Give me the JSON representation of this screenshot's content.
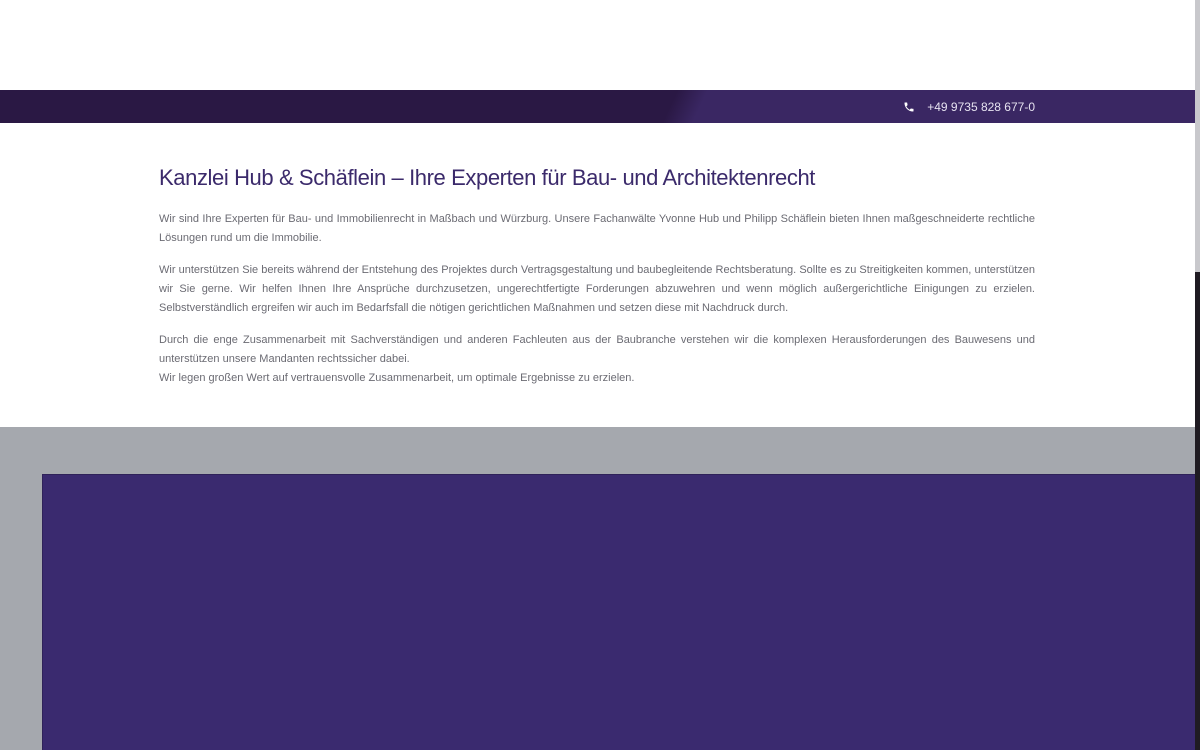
{
  "topbar": {
    "phone": "+49 9735 828 677-0",
    "phone_icon": "phone-icon"
  },
  "intro": {
    "title": "Kanzlei Hub & Schäflein – Ihre Experten für Bau- und Architektenrecht",
    "paragraphs": [
      "Wir sind Ihre Experten für Bau- und Immobilienrecht in Maßbach und Würzburg. Unsere Fachanwälte Yvonne Hub und Philipp Schäflein bieten Ihnen maßgeschneiderte rechtliche Lösungen rund um die Immobilie.",
      "Wir unterstützen Sie bereits während der Entstehung des Projektes durch Vertragsgestaltung und baubegleitende Rechtsberatung. Sollte es zu Streitigkeiten kommen, unterstützen wir Sie gerne. Wir helfen Ihnen Ihre Ansprüche durchzusetzen, ungerechtfertigte Forderungen abzuwehren und wenn möglich außergerichtliche Einigungen zu erzielen. Selbstverständlich ergreifen wir auch im Bedarfsfall die nötigen gerichtlichen Maßnahmen und setzen diese mit Nachdruck durch.",
      "Durch die enge Zusammenarbeit mit Sachverständigen und anderen Fachleuten aus der Baubranche verstehen wir die komplexen Herausforderungen des Bauwesens und unterstützen unsere Mandanten rechtssicher dabei."
    ],
    "closing_line": "Wir legen großen Wert auf vertrauensvolle Zusammenarbeit, um optimale Ergebnisse zu erzielen."
  },
  "colors": {
    "brand_purple": "#3a2a6f",
    "topbar_dark": "#2a1844",
    "title_color": "#3b2a6b",
    "gray_band": "#a5a8ae"
  }
}
